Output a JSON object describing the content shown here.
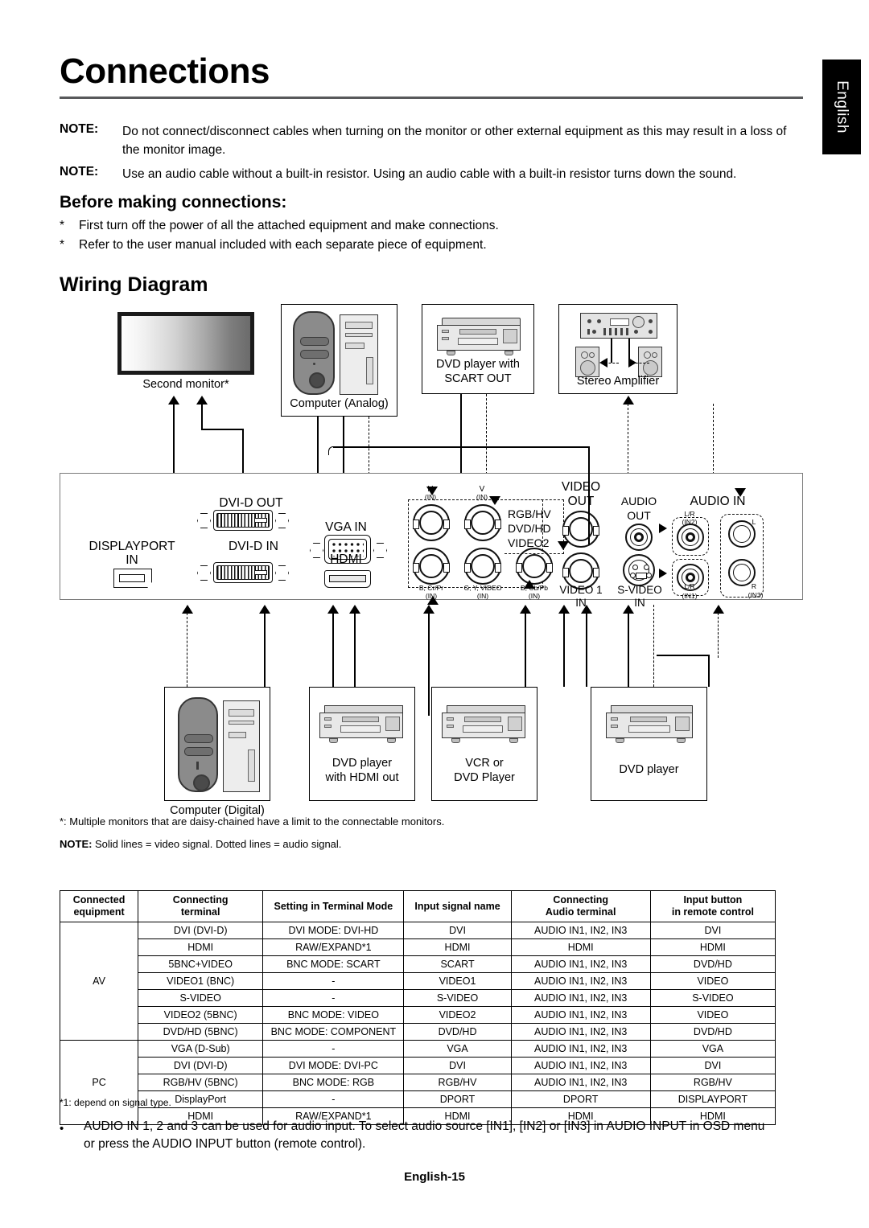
{
  "lang_tab": "English",
  "title": "Connections",
  "notes": [
    {
      "label": "NOTE:",
      "text": "Do not connect/disconnect cables when turning on the monitor or other external equipment as this may result in a loss of the monitor image."
    },
    {
      "label": "NOTE:",
      "text": "Use an audio cable without a built-in resistor. Using an audio cable with a built-in resistor turns down the sound."
    }
  ],
  "before_heading": "Before making connections:",
  "before_items": [
    "First turn off the power of all the attached equipment and make connections.",
    "Refer to the user manual included with each separate piece of equipment."
  ],
  "wiring_heading": "Wiring Diagram",
  "diagram": {
    "equipment_top": [
      {
        "name": "second-monitor",
        "caption": "Second monitor*"
      },
      {
        "name": "computer-analog",
        "caption": "Computer (Analog)"
      },
      {
        "name": "dvd-scart",
        "caption": "DVD player with\nSCART OUT",
        "line1": "DVD player with",
        "line2": "SCART OUT"
      },
      {
        "name": "stereo-amplifier",
        "caption": "Stereo Amplifier"
      }
    ],
    "equipment_bottom": [
      {
        "name": "computer-digital",
        "caption": "Computer (Digital)"
      },
      {
        "name": "dvd-hdmi",
        "line1": "DVD player",
        "line2": "with HDMI out"
      },
      {
        "name": "vcr-dvd",
        "line1": "VCR or",
        "line2": "DVD Player"
      },
      {
        "name": "dvd-player",
        "line1": "DVD player",
        "line2": ""
      }
    ],
    "panel": {
      "dvi_d_out": "DVI-D OUT",
      "dvi_d_in": "DVI-D IN",
      "displayport_in_l1": "DISPLAYPORT",
      "displayport_in_l2": "IN",
      "vga_in": "VGA IN",
      "hdmi": "HDMI",
      "bnc_h": "H",
      "bnc_h_in": "(IN)",
      "bnc_v": "V",
      "bnc_v_in": "(IN)",
      "bnc_b_crpr": "B, Cr/Pr",
      "bnc_b_crpr_in": "(IN)",
      "bnc_gy_video": "G, Y, VIDEO",
      "bnc_gy_video_in": "(IN)",
      "bnc_b_cbpb": "B, Cb/Pb",
      "bnc_b_cbpb_in": "(IN)",
      "bnc_group_l1": "RGB/HV",
      "bnc_group_l2": "DVD/HD",
      "bnc_group_l3": "VIDEO2",
      "video_out_l1": "VIDEO",
      "video_out_l2": "OUT",
      "video1_in_l1": "VIDEO 1",
      "video1_in_l2": "IN",
      "audio_out_l1": "AUDIO",
      "audio_out_l2": "OUT",
      "svideo_in_l1": "S-VIDEO",
      "svideo_in_l2": "IN",
      "audio_in": "AUDIO IN",
      "audio_in2_lr": "L/R",
      "audio_in2": "(IN2)",
      "audio_in1_lr": "L/R",
      "audio_in1": "(IN1)",
      "audio_in3_l": "L",
      "audio_in3_r": "R",
      "audio_in3": "(IN3)"
    },
    "footnote_star": "*: Multiple monitors that are daisy-chained have a limit to the connectable monitors.",
    "note_lines_label": "NOTE:",
    "note_lines_text": "Solid lines = video signal. Dotted lines = audio signal."
  },
  "table": {
    "headers": [
      {
        "l1": "Connected",
        "l2": "equipment"
      },
      {
        "l1": "Connecting",
        "l2": "terminal"
      },
      {
        "l1": "Setting in Terminal Mode",
        "l2": ""
      },
      {
        "l1": "Input signal name",
        "l2": ""
      },
      {
        "l1": "Connecting",
        "l2": "Audio terminal"
      },
      {
        "l1": "Input button",
        "l2": "in remote control"
      }
    ],
    "groups": [
      {
        "name": "AV",
        "rows": [
          {
            "terminal": "DVI (DVI-D)",
            "setting": "DVI MODE: DVI-HD",
            "signal": "DVI",
            "audio": "AUDIO IN1, IN2, IN3",
            "button": "DVI"
          },
          {
            "terminal": "HDMI",
            "setting": "RAW/EXPAND*1",
            "signal": "HDMI",
            "audio": "HDMI",
            "button": "HDMI"
          },
          {
            "terminal": "5BNC+VIDEO",
            "setting": "BNC MODE: SCART",
            "signal": "SCART",
            "audio": "AUDIO IN1, IN2, IN3",
            "button": "DVD/HD"
          },
          {
            "terminal": "VIDEO1 (BNC)",
            "setting": "-",
            "signal": "VIDEO1",
            "audio": "AUDIO IN1, IN2, IN3",
            "button": "VIDEO"
          },
          {
            "terminal": "S-VIDEO",
            "setting": "-",
            "signal": "S-VIDEO",
            "audio": "AUDIO IN1, IN2, IN3",
            "button": "S-VIDEO"
          },
          {
            "terminal": "VIDEO2 (5BNC)",
            "setting": "BNC MODE: VIDEO",
            "signal": "VIDEO2",
            "audio": "AUDIO IN1, IN2, IN3",
            "button": "VIDEO"
          },
          {
            "terminal": "DVD/HD (5BNC)",
            "setting": "BNC MODE: COMPONENT",
            "signal": "DVD/HD",
            "audio": "AUDIO IN1, IN2, IN3",
            "button": "DVD/HD"
          }
        ]
      },
      {
        "name": "PC",
        "rows": [
          {
            "terminal": "VGA (D-Sub)",
            "setting": "-",
            "signal": "VGA",
            "audio": "AUDIO IN1, IN2, IN3",
            "button": "VGA"
          },
          {
            "terminal": "DVI (DVI-D)",
            "setting": "DVI MODE: DVI-PC",
            "signal": "DVI",
            "audio": "AUDIO IN1, IN2, IN3",
            "button": "DVI"
          },
          {
            "terminal": "RGB/HV (5BNC)",
            "setting": "BNC MODE: RGB",
            "signal": "RGB/HV",
            "audio": "AUDIO IN1, IN2, IN3",
            "button": "RGB/HV"
          },
          {
            "terminal": "DisplayPort",
            "setting": "-",
            "signal": "DPORT",
            "audio": "DPORT",
            "button": "DISPLAYPORT"
          },
          {
            "terminal": "HDMI",
            "setting": "RAW/EXPAND*1",
            "signal": "HDMI",
            "audio": "HDMI",
            "button": "HDMI"
          }
        ]
      }
    ]
  },
  "table_footnote": "*1: depend on signal type.",
  "bullet": {
    "marker": "•",
    "line1": "AUDIO IN 1, 2 and 3 can be used for audio input. To select audio source [IN1], [IN2] or [IN3] in AUDIO INPUT in OSD menu",
    "line2": "or press the AUDIO INPUT button (remote control)."
  },
  "footer": "English-15"
}
